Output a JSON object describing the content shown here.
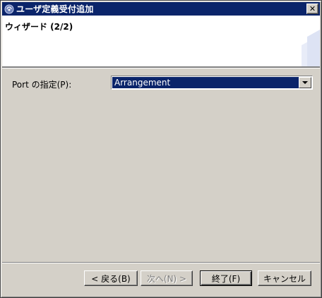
{
  "window": {
    "title": "ユーザ定義受付追加"
  },
  "banner": {
    "title": "ウィザード (2/2)"
  },
  "form": {
    "port_label": "Port の指定(P):",
    "port_value": "Arrangement"
  },
  "buttons": {
    "back": "< 戻る(B)",
    "next": "次へ(N) >",
    "finish": "終了(F)",
    "cancel": "キャンセル"
  },
  "colors": {
    "titlebar": "#0a246a",
    "face": "#d4d0c8",
    "banner_bg": "#ffffff"
  }
}
